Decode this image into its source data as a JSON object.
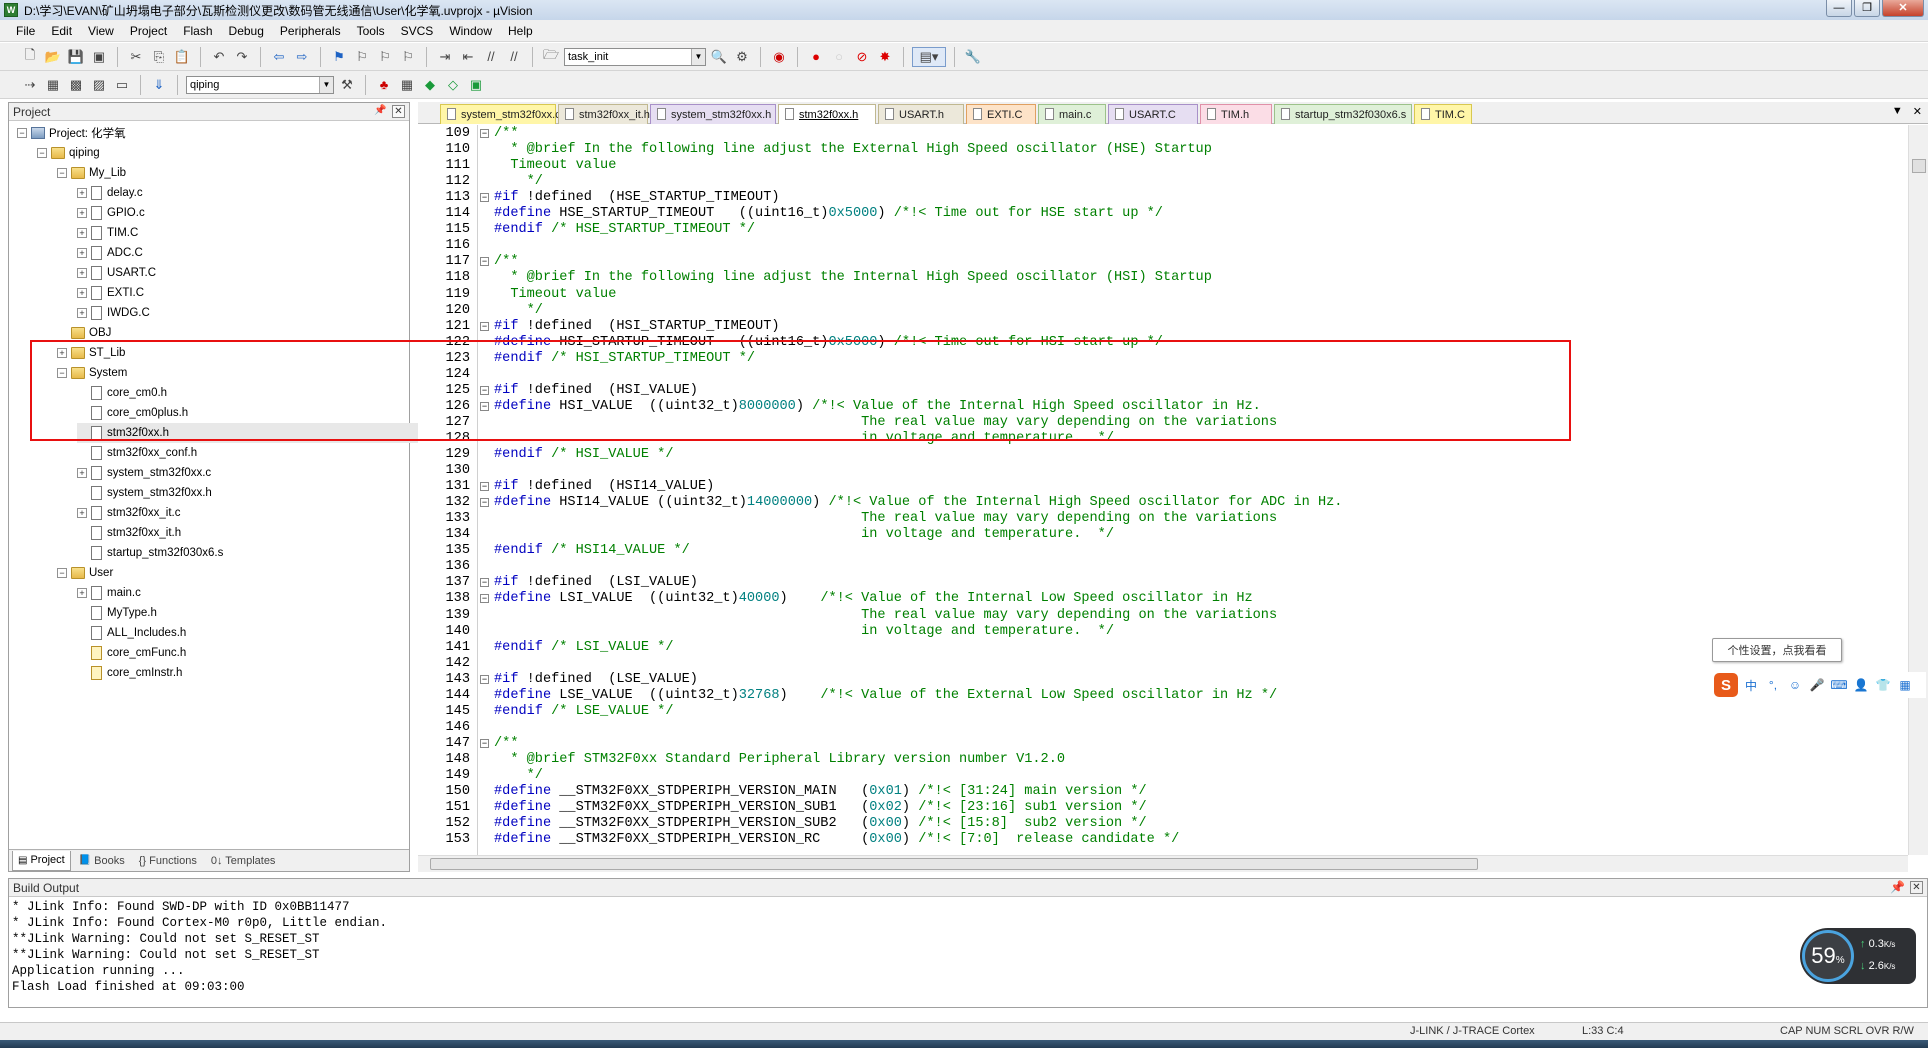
{
  "window": {
    "title": "D:\\学习\\EVAN\\矿山坍塌电子部分\\瓦斯检测仪更改\\数码管无线通信\\User\\化学氧.uvprojx - µVision",
    "buttons": [
      "—",
      "❐",
      "✕"
    ]
  },
  "menu": [
    "File",
    "Edit",
    "View",
    "Project",
    "Flash",
    "Debug",
    "Peripherals",
    "Tools",
    "SVCS",
    "Window",
    "Help"
  ],
  "toolbar": {
    "find_combo": "task_init",
    "target_combo": "qiping"
  },
  "project_panel": {
    "title": "Project",
    "tree": [
      {
        "label": "Project: 化学氧",
        "level": 0,
        "type": "project",
        "expanded": true
      },
      {
        "label": "qiping",
        "level": 1,
        "type": "target",
        "expanded": true
      },
      {
        "label": "My_Lib",
        "level": 2,
        "type": "folder",
        "expanded": true
      },
      {
        "label": "delay.c",
        "level": 3,
        "type": "file",
        "expandable": true
      },
      {
        "label": "GPIO.c",
        "level": 3,
        "type": "file",
        "expandable": true
      },
      {
        "label": "TIM.C",
        "level": 3,
        "type": "file",
        "expandable": true
      },
      {
        "label": "ADC.C",
        "level": 3,
        "type": "file",
        "expandable": true
      },
      {
        "label": "USART.C",
        "level": 3,
        "type": "file",
        "expandable": true
      },
      {
        "label": "EXTI.C",
        "level": 3,
        "type": "file",
        "expandable": true
      },
      {
        "label": "IWDG.C",
        "level": 3,
        "type": "file",
        "expandable": true
      },
      {
        "label": "OBJ",
        "level": 2,
        "type": "folder",
        "expandable": false
      },
      {
        "label": "ST_Lib",
        "level": 2,
        "type": "folder",
        "expandable": true,
        "collapsed": true
      },
      {
        "label": "System",
        "level": 2,
        "type": "folder",
        "expanded": true
      },
      {
        "label": "core_cm0.h",
        "level": 3,
        "type": "file"
      },
      {
        "label": "core_cm0plus.h",
        "level": 3,
        "type": "file"
      },
      {
        "label": "stm32f0xx.h",
        "level": 3,
        "type": "file",
        "selected": true
      },
      {
        "label": "stm32f0xx_conf.h",
        "level": 3,
        "type": "file"
      },
      {
        "label": "system_stm32f0xx.c",
        "level": 3,
        "type": "file",
        "expandable": true
      },
      {
        "label": "system_stm32f0xx.h",
        "level": 3,
        "type": "file"
      },
      {
        "label": "stm32f0xx_it.c",
        "level": 3,
        "type": "file",
        "expandable": true
      },
      {
        "label": "stm32f0xx_it.h",
        "level": 3,
        "type": "file"
      },
      {
        "label": "startup_stm32f030x6.s",
        "level": 3,
        "type": "file"
      },
      {
        "label": "User",
        "level": 2,
        "type": "folder",
        "expanded": true
      },
      {
        "label": "main.c",
        "level": 3,
        "type": "file",
        "expandable": true
      },
      {
        "label": "MyType.h",
        "level": 3,
        "type": "file"
      },
      {
        "label": "ALL_Includes.h",
        "level": 3,
        "type": "file"
      },
      {
        "label": "core_cmFunc.h",
        "level": 3,
        "type": "file",
        "locked": true
      },
      {
        "label": "core_cmInstr.h",
        "level": 3,
        "type": "file",
        "locked": true
      }
    ],
    "tabs": [
      "Project",
      "Books",
      "{} Functions",
      "0↓ Templates"
    ]
  },
  "editor": {
    "tabs": [
      {
        "label": "system_stm32f0xx.c",
        "color": "yellow"
      },
      {
        "label": "stm32f0xx_it.h",
        "color": "plain"
      },
      {
        "label": "system_stm32f0xx.h",
        "color": "purple"
      },
      {
        "label": "stm32f0xx.h",
        "color": "active"
      },
      {
        "label": "USART.h",
        "color": "plain"
      },
      {
        "label": "EXTI.C",
        "color": "orange"
      },
      {
        "label": "main.c",
        "color": "green"
      },
      {
        "label": "USART.C",
        "color": "purple"
      },
      {
        "label": "TIM.h",
        "color": "pink"
      },
      {
        "label": "startup_stm32f030x6.s",
        "color": "green"
      },
      {
        "label": "TIM.C",
        "color": "yellow"
      }
    ],
    "tab_controls": [
      "▼",
      "✕"
    ],
    "lines": [
      {
        "n": "109",
        "fold": "open",
        "segs": [
          {
            "t": "/**",
            "c": "cm"
          }
        ]
      },
      {
        "n": "110",
        "segs": [
          {
            "t": "  * @brief In the following line adjust the External High Speed oscillator (HSE) Startup",
            "c": "cm"
          }
        ]
      },
      {
        "n": "111",
        "segs": [
          {
            "t": "  Timeout value",
            "c": "cm"
          }
        ]
      },
      {
        "n": "112",
        "segs": [
          {
            "t": "    */",
            "c": "cm"
          }
        ]
      },
      {
        "n": "113",
        "fold": "open",
        "segs": [
          {
            "t": "#if",
            "c": "pp"
          },
          {
            "t": " !defined  (HSE_STARTUP_TIMEOUT)",
            "c": ""
          }
        ]
      },
      {
        "n": "114",
        "segs": [
          {
            "t": "#define",
            "c": "pp"
          },
          {
            "t": " HSE_STARTUP_TIMEOUT   ((uint16_t)",
            "c": ""
          },
          {
            "t": "0x5000",
            "c": "nm"
          },
          {
            "t": ") ",
            "c": ""
          },
          {
            "t": "/*!< Time out for HSE start up */",
            "c": "cm"
          }
        ]
      },
      {
        "n": "115",
        "segs": [
          {
            "t": "#endif",
            "c": "pp"
          },
          {
            "t": " /* HSE_STARTUP_TIMEOUT */",
            "c": "cm"
          }
        ]
      },
      {
        "n": "116",
        "segs": []
      },
      {
        "n": "117",
        "fold": "open",
        "segs": [
          {
            "t": "/**",
            "c": "cm"
          }
        ]
      },
      {
        "n": "118",
        "segs": [
          {
            "t": "  * @brief In the following line adjust the Internal High Speed oscillator (HSI) Startup",
            "c": "cm"
          }
        ]
      },
      {
        "n": "119",
        "segs": [
          {
            "t": "  Timeout value",
            "c": "cm"
          }
        ]
      },
      {
        "n": "120",
        "segs": [
          {
            "t": "    */",
            "c": "cm"
          }
        ]
      },
      {
        "n": "121",
        "fold": "open",
        "segs": [
          {
            "t": "#if",
            "c": "pp"
          },
          {
            "t": " !defined  (HSI_STARTUP_TIMEOUT)",
            "c": ""
          }
        ]
      },
      {
        "n": "122",
        "segs": [
          {
            "t": "#define",
            "c": "pp"
          },
          {
            "t": " HSI_STARTUP_TIMEOUT   ((uint16_t)",
            "c": ""
          },
          {
            "t": "0x5000",
            "c": "nm"
          },
          {
            "t": ") ",
            "c": ""
          },
          {
            "t": "/*!< Time out for HSI start up */",
            "c": "cm"
          }
        ]
      },
      {
        "n": "123",
        "segs": [
          {
            "t": "#endif",
            "c": "pp"
          },
          {
            "t": " /* HSI_STARTUP_TIMEOUT */",
            "c": "cm"
          }
        ]
      },
      {
        "n": "124",
        "segs": []
      },
      {
        "n": "125",
        "fold": "open",
        "segs": [
          {
            "t": "#if",
            "c": "pp"
          },
          {
            "t": " !defined  (HSI_VALUE)",
            "c": ""
          }
        ]
      },
      {
        "n": "126",
        "fold": "open",
        "segs": [
          {
            "t": "#define",
            "c": "pp"
          },
          {
            "t": " HSI_VALUE  ((uint32_t)",
            "c": ""
          },
          {
            "t": "8000000",
            "c": "nm"
          },
          {
            "t": ") ",
            "c": ""
          },
          {
            "t": "/*!< Value of the Internal High Speed oscillator in Hz.",
            "c": "cm"
          }
        ]
      },
      {
        "n": "127",
        "segs": [
          {
            "t": "                                             The real value may vary depending on the variations",
            "c": "cm"
          }
        ]
      },
      {
        "n": "128",
        "segs": [
          {
            "t": "                                             in voltage and temperature.  */",
            "c": "cm"
          }
        ]
      },
      {
        "n": "129",
        "segs": [
          {
            "t": "#endif",
            "c": "pp"
          },
          {
            "t": " /* HSI_VALUE */",
            "c": "cm"
          }
        ]
      },
      {
        "n": "130",
        "segs": []
      },
      {
        "n": "131",
        "fold": "open",
        "segs": [
          {
            "t": "#if",
            "c": "pp"
          },
          {
            "t": " !defined  (HSI14_VALUE)",
            "c": ""
          }
        ]
      },
      {
        "n": "132",
        "fold": "open",
        "segs": [
          {
            "t": "#define",
            "c": "pp"
          },
          {
            "t": " HSI14_VALUE ((uint32_t)",
            "c": ""
          },
          {
            "t": "14000000",
            "c": "nm"
          },
          {
            "t": ") ",
            "c": ""
          },
          {
            "t": "/*!< Value of the Internal High Speed oscillator for ADC in Hz.",
            "c": "cm"
          }
        ]
      },
      {
        "n": "133",
        "segs": [
          {
            "t": "                                             The real value may vary depending on the variations",
            "c": "cm"
          }
        ]
      },
      {
        "n": "134",
        "segs": [
          {
            "t": "                                             in voltage and temperature.  */",
            "c": "cm"
          }
        ]
      },
      {
        "n": "135",
        "segs": [
          {
            "t": "#endif",
            "c": "pp"
          },
          {
            "t": " /* HSI14_VALUE */",
            "c": "cm"
          }
        ]
      },
      {
        "n": "136",
        "segs": []
      },
      {
        "n": "137",
        "fold": "open",
        "segs": [
          {
            "t": "#if",
            "c": "pp"
          },
          {
            "t": " !defined  (LSI_VALUE)",
            "c": ""
          }
        ]
      },
      {
        "n": "138",
        "fold": "open",
        "segs": [
          {
            "t": "#define",
            "c": "pp"
          },
          {
            "t": " LSI_VALUE  ((uint32_t)",
            "c": ""
          },
          {
            "t": "40000",
            "c": "nm"
          },
          {
            "t": ")    ",
            "c": ""
          },
          {
            "t": "/*!< Value of the Internal Low Speed oscillator in Hz",
            "c": "cm"
          }
        ]
      },
      {
        "n": "139",
        "segs": [
          {
            "t": "                                             The real value may vary depending on the variations",
            "c": "cm"
          }
        ]
      },
      {
        "n": "140",
        "segs": [
          {
            "t": "                                             in voltage and temperature.  */",
            "c": "cm"
          }
        ]
      },
      {
        "n": "141",
        "segs": [
          {
            "t": "#endif",
            "c": "pp"
          },
          {
            "t": " /* LSI_VALUE */",
            "c": "cm"
          }
        ]
      },
      {
        "n": "142",
        "segs": []
      },
      {
        "n": "143",
        "fold": "open",
        "segs": [
          {
            "t": "#if",
            "c": "pp"
          },
          {
            "t": " !defined  (LSE_VALUE)",
            "c": ""
          }
        ]
      },
      {
        "n": "144",
        "segs": [
          {
            "t": "#define",
            "c": "pp"
          },
          {
            "t": " LSE_VALUE  ((uint32_t)",
            "c": ""
          },
          {
            "t": "32768",
            "c": "nm"
          },
          {
            "t": ")    ",
            "c": ""
          },
          {
            "t": "/*!< Value of the External Low Speed oscillator in Hz */",
            "c": "cm"
          }
        ]
      },
      {
        "n": "145",
        "segs": [
          {
            "t": "#endif",
            "c": "pp"
          },
          {
            "t": " /* LSE_VALUE */",
            "c": "cm"
          }
        ]
      },
      {
        "n": "146",
        "segs": []
      },
      {
        "n": "147",
        "fold": "open",
        "segs": [
          {
            "t": "/**",
            "c": "cm"
          }
        ]
      },
      {
        "n": "148",
        "segs": [
          {
            "t": "  * @brief STM32F0xx Standard Peripheral Library version number V1.2.0",
            "c": "cm"
          }
        ]
      },
      {
        "n": "149",
        "segs": [
          {
            "t": "    */",
            "c": "cm"
          }
        ]
      },
      {
        "n": "150",
        "segs": [
          {
            "t": "#define",
            "c": "pp"
          },
          {
            "t": " __STM32F0XX_STDPERIPH_VERSION_MAIN   (",
            "c": ""
          },
          {
            "t": "0x01",
            "c": "nm"
          },
          {
            "t": ") ",
            "c": ""
          },
          {
            "t": "/*!< [31:24] main version */",
            "c": "cm"
          }
        ]
      },
      {
        "n": "151",
        "segs": [
          {
            "t": "#define",
            "c": "pp"
          },
          {
            "t": " __STM32F0XX_STDPERIPH_VERSION_SUB1   (",
            "c": ""
          },
          {
            "t": "0x02",
            "c": "nm"
          },
          {
            "t": ") ",
            "c": ""
          },
          {
            "t": "/*!< [23:16] sub1 version */",
            "c": "cm"
          }
        ]
      },
      {
        "n": "152",
        "segs": [
          {
            "t": "#define",
            "c": "pp"
          },
          {
            "t": " __STM32F0XX_STDPERIPH_VERSION_SUB2   (",
            "c": ""
          },
          {
            "t": "0x00",
            "c": "nm"
          },
          {
            "t": ") ",
            "c": ""
          },
          {
            "t": "/*!< [15:8]  sub2 version */",
            "c": "cm"
          }
        ]
      },
      {
        "n": "153",
        "segs": [
          {
            "t": "#define",
            "c": "pp"
          },
          {
            "t": " __STM32F0XX_STDPERIPH_VERSION_RC     (",
            "c": ""
          },
          {
            "t": "0x00",
            "c": "nm"
          },
          {
            "t": ") ",
            "c": ""
          },
          {
            "t": "/*!< [7:0]  release candidate */",
            "c": "cm"
          }
        ]
      }
    ]
  },
  "build_output": {
    "title": "Build Output",
    "text": "* JLink Info: Found SWD-DP with ID 0x0BB11477\n* JLink Info: Found Cortex-M0 r0p0, Little endian.\n**JLink Warning: Could not set S_RESET_ST\n**JLink Warning: Could not set S_RESET_ST\nApplication running ...\nFlash Load finished at 09:03:00"
  },
  "statusbar": {
    "debugger": "J-LINK / J-TRACE Cortex",
    "position": "L:33 C:4",
    "keys": "CAP  NUM  SCRL  OVR  R/W"
  },
  "ime": {
    "tooltip": "个性设置，点我看看",
    "logo": "S",
    "mode": "中"
  },
  "net_widget": {
    "percent": "59",
    "unit": "%",
    "up": "0.3",
    "down": "2.6",
    "rate_unit": "K/s"
  }
}
